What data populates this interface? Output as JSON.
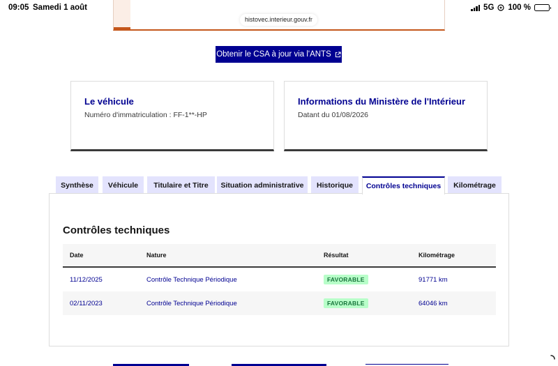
{
  "status_bar": {
    "time": "09:05",
    "date": "Samedi 1 août",
    "network": "5G",
    "battery": "100 %"
  },
  "browser": {
    "url": "histovec.interieur.gouv.fr"
  },
  "cta": {
    "label": "Obtenir le CSA à jour via l'ANTS",
    "icon": "external-link-icon"
  },
  "cards": [
    {
      "title": "Le véhicule",
      "subtitle": "Numéro d'immatriculation : FF-1**-HP"
    },
    {
      "title": "Informations du Ministère de l'Intérieur",
      "subtitle": "Datant du 01/08/2026"
    }
  ],
  "tabs": [
    {
      "label": "Synthèse",
      "active": false
    },
    {
      "label": "Véhicule",
      "active": false
    },
    {
      "label": "Titulaire et Titre",
      "active": false
    },
    {
      "label": "Situation administrative",
      "active": false
    },
    {
      "label": "Historique",
      "active": false
    },
    {
      "label": "Contrôles techniques",
      "active": true
    },
    {
      "label": "Kilométrage",
      "active": false
    }
  ],
  "section": {
    "title": "Contrôles techniques",
    "columns": [
      "Date",
      "Nature",
      "Résultat",
      "Kilométrage"
    ],
    "rows": [
      {
        "date": "11/12/2025",
        "nature": "Contrôle Technique Périodique",
        "result": "FAVORABLE",
        "km": "91771 km"
      },
      {
        "date": "02/11/2023",
        "nature": "Contrôle Technique Périodique",
        "result": "FAVORABLE",
        "km": "64046 km"
      }
    ]
  },
  "colors": {
    "primary": "#000091",
    "tab_bg": "#e3e3fd",
    "success_bg": "#b8fec9",
    "success_text": "#18753c",
    "alert_accent": "#c4571b"
  }
}
